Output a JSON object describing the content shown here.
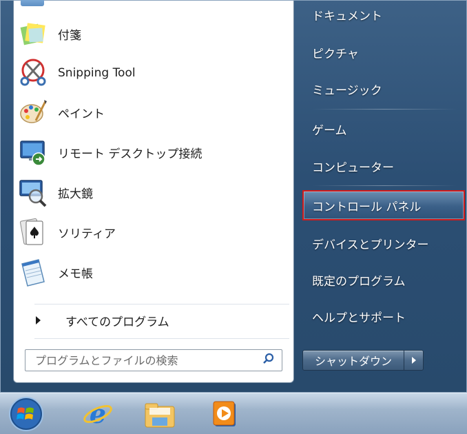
{
  "programs": [
    {
      "label": "付箋",
      "icon": "sticky-notes-icon"
    },
    {
      "label": "Snipping Tool",
      "icon": "scissors-icon"
    },
    {
      "label": "ペイント",
      "icon": "paint-palette-icon"
    },
    {
      "label": "リモート デスクトップ接続",
      "icon": "remote-desktop-icon"
    },
    {
      "label": "拡大鏡",
      "icon": "magnifier-icon"
    },
    {
      "label": "ソリティア",
      "icon": "playing-card-icon"
    },
    {
      "label": "メモ帳",
      "icon": "notepad-icon"
    }
  ],
  "all_programs": {
    "label": "すべてのプログラム"
  },
  "search": {
    "placeholder": "プログラムとファイルの検索"
  },
  "right_pane": {
    "documents": "ドキュメント",
    "pictures": "ピクチャ",
    "music": "ミュージック",
    "games": "ゲーム",
    "computer": "コンピューター",
    "control_panel": "コントロール パネル",
    "devices_printers": "デバイスとプリンター",
    "default_programs": "既定のプログラム",
    "help_support": "ヘルプとサポート"
  },
  "shutdown": {
    "label": "シャットダウン"
  },
  "taskbar": {
    "items": [
      "windows-orb-icon",
      "internet-explorer-icon",
      "file-explorer-icon",
      "media-player-icon"
    ]
  },
  "colors": {
    "highlight_border": "#d21a1a"
  }
}
